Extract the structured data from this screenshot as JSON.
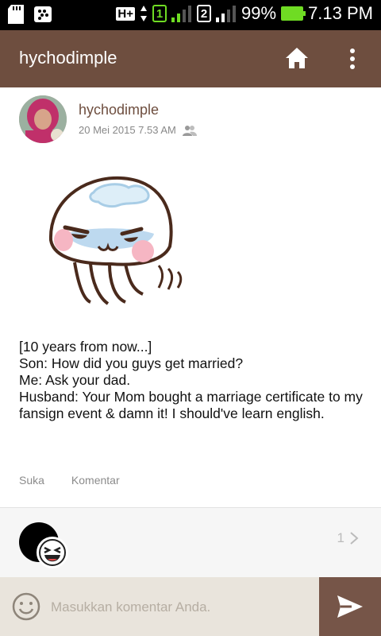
{
  "status_bar": {
    "network_type": "H+",
    "sim1": "1",
    "sim2": "2",
    "battery": "99%",
    "time": "7.13 PM"
  },
  "app_bar": {
    "title": "hychodimple",
    "home_icon": "home-icon",
    "more_icon": "more-vertical-icon"
  },
  "post": {
    "author": "hychodimple",
    "datetime": "20 Mei 2015 7.53 AM",
    "visibility_icon": "friends-icon",
    "text": "[10 years from now...]\nSon: How did you guys get married?\nMe: Ask your dad.\nHusband: Your Mom bought a marriage certificate to my fansign event & damn it! I should've learn english.",
    "actions": {
      "like": "Suka",
      "comment": "Komentar"
    }
  },
  "comments_preview": {
    "count": "1"
  },
  "comment_input": {
    "placeholder": "Masukkan komentar Anda."
  },
  "colors": {
    "app_bar": "#6e4e3f",
    "send_button": "#765548",
    "input_bar": "#e9e4dc",
    "battery": "#6fdc23"
  }
}
